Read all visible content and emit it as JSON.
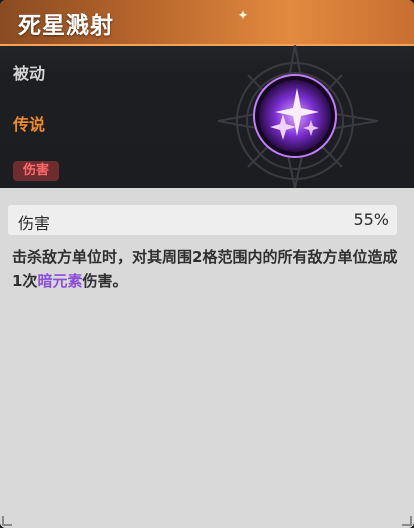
{
  "skill": {
    "name": "死星溅射",
    "type": "被动",
    "rarity": "传说",
    "tag": "伤害"
  },
  "stat": {
    "label": "伤害",
    "value": "55%"
  },
  "description": {
    "prefix": "击杀敌方单位时，对其周围2格范围内的所有敌方单位造成1次",
    "highlight": "暗元素",
    "suffix": "伤害。"
  },
  "colors": {
    "title_bar": "#c86f31",
    "rarity": "#f08a2c",
    "tag_bg": "#6d2d2e",
    "tag_text": "#ff6a6a",
    "dark_element": "#8c4fd8",
    "icon_glow": "#b86bff"
  },
  "icons": {
    "skill": "purple-star-burst-icon",
    "emblem": "compass-star-emblem"
  }
}
